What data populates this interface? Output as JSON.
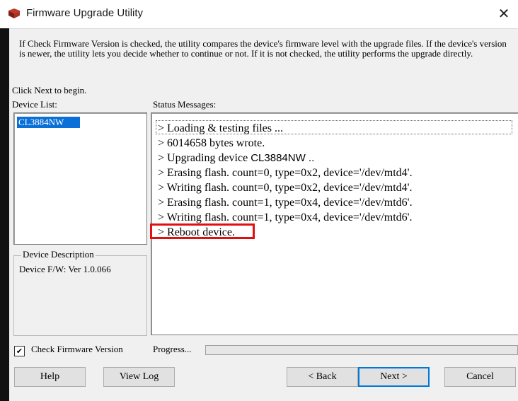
{
  "window": {
    "title": "Firmware Upgrade Utility",
    "close_icon": "close-icon",
    "app_icon": "firmware-app-icon"
  },
  "intro": {
    "text": "If Check Firmware Version is checked, the utility compares the device's firmware level with the upgrade files. If the device's version is newer, the utility lets you decide whether to continue or not. If it is not checked, the utility performs the upgrade directly.",
    "begin": "Click Next to begin."
  },
  "device_list": {
    "label": "Device List:",
    "items": [
      "CL3884NW"
    ],
    "selected_color": "#0a70d8"
  },
  "status": {
    "label": "Status Messages:",
    "lines": [
      "> Loading & testing files ...",
      "> 6014658 bytes wrote.",
      "> Upgrading device",
      "> Erasing flash. count=0, type=0x2, device='/dev/mtd4'.",
      "> Writing flash. count=0, type=0x2, device='/dev/mtd4'.",
      "> Erasing flash. count=1, type=0x4, device='/dev/mtd6'.",
      "> Writing flash. count=1, type=0x4, device='/dev/mtd6'.",
      "> Reboot device."
    ],
    "upgrading_device_name": "CL3884NW ..",
    "highlight_color": "#e01010"
  },
  "description": {
    "title": "Device Description",
    "text": "Device F/W: Ver 1.0.066"
  },
  "footer": {
    "check_label": "Check Firmware Version",
    "check_mark": "✔",
    "checked": true,
    "progress_label": "Progress...",
    "progress_fraction": 0
  },
  "buttons": {
    "help": "Help",
    "view_log": "View Log",
    "back": "< Back",
    "next": "Next >",
    "cancel": "Cancel"
  }
}
